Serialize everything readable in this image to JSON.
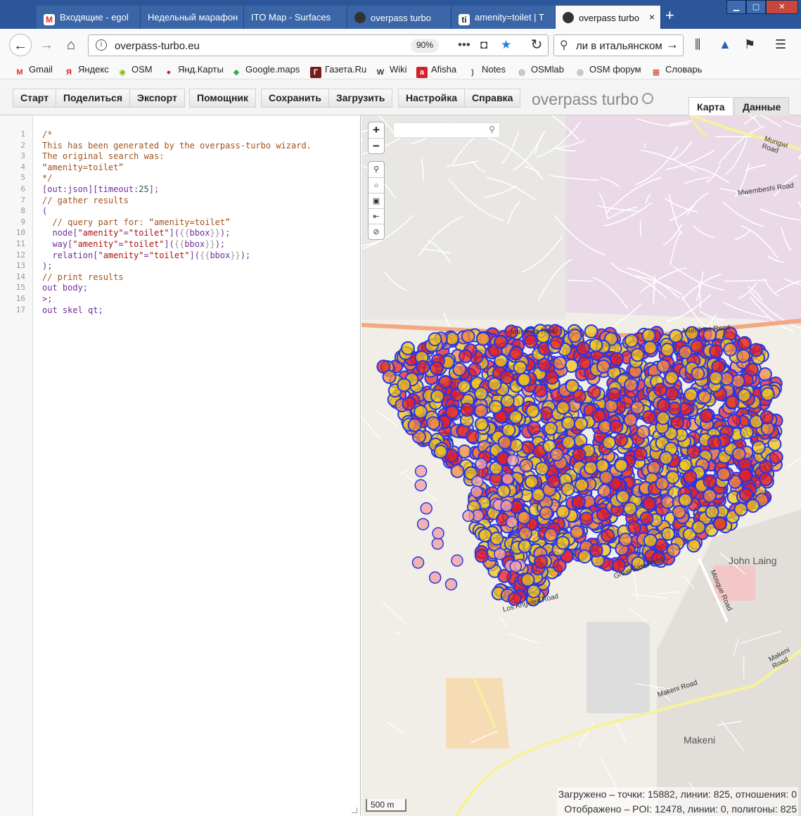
{
  "browser": {
    "tabs": [
      {
        "title": "Входящие - egol",
        "icon_color": "#d93025"
      },
      {
        "title": "Недельный марафон"
      },
      {
        "title": "ITO Map - Surfaces"
      },
      {
        "title": "overpass turbo",
        "icon_color": "#333333"
      },
      {
        "title": "amenity=toilet | T",
        "icon_color": "#222222"
      },
      {
        "title": "overpass turbo",
        "active": true,
        "icon_color": "#333333"
      }
    ],
    "close_tab": "×",
    "new_tab": "+",
    "url": "overpass-turbo.eu",
    "zoom": "90%",
    "search_text": "ли в итальянском"
  },
  "bookmarks": [
    {
      "label": "Gmail",
      "icon": "M",
      "color": "#d93025"
    },
    {
      "label": "Яндекс",
      "icon": "Я",
      "color": "#e02020"
    },
    {
      "label": "OSM",
      "icon": "◉",
      "color": "#7ab800"
    },
    {
      "label": "Янд.Карты",
      "icon": "📍",
      "color": "#e02020"
    },
    {
      "label": "Google.maps",
      "icon": "◆",
      "color": "#34a853"
    },
    {
      "label": "Газета.Ru",
      "icon": "Г",
      "color": "#7a1b1b"
    },
    {
      "label": "Wiki",
      "icon": "W",
      "color": "#333333"
    },
    {
      "label": "Afisha",
      "icon": "a",
      "color": "#d4202a"
    },
    {
      "label": "Notes",
      "icon": ")",
      "color": "#555555"
    },
    {
      "label": "OSMlab",
      "icon": "◎",
      "color": "#555555"
    },
    {
      "label": "OSM форум",
      "icon": "◎",
      "color": "#555555"
    },
    {
      "label": "Словарь",
      "icon": "▦",
      "color": "#c0392b"
    }
  ],
  "toolbar": {
    "group1": [
      "Старт",
      "Поделиться",
      "Экспорт"
    ],
    "group2": [
      "Помощник"
    ],
    "group3": [
      "Сохранить",
      "Загрузить"
    ],
    "group4": [
      "Настройка",
      "Справка"
    ],
    "brand": "overpass turbo",
    "view_tabs": [
      "Карта",
      "Данные"
    ]
  },
  "editor": {
    "lines": [
      [
        [
          "c-comment",
          "/*"
        ]
      ],
      [
        [
          "c-comment",
          "This has been generated by the overpass-turbo wizard."
        ]
      ],
      [
        [
          "c-comment",
          "The original search was:"
        ]
      ],
      [
        [
          "c-comment",
          "“amenity=toilet”"
        ]
      ],
      [
        [
          "c-comment",
          "*/"
        ]
      ],
      [
        [
          "c-key",
          "[out:json][timeout:"
        ],
        [
          "c-num",
          "25"
        ],
        [
          "c-key",
          "];"
        ]
      ],
      [
        [
          "c-comment",
          "// gather results"
        ]
      ],
      [
        [
          "c-key",
          "("
        ]
      ],
      [
        [
          "c-comment",
          "  // query part for: “amenity=toilet”"
        ]
      ],
      [
        [
          "c-key",
          "  node["
        ],
        [
          "c-str",
          "\"amenity\""
        ],
        [
          "c-key",
          "="
        ],
        [
          "c-str",
          "\"toilet\""
        ],
        [
          "c-key",
          "]("
        ],
        [
          "c-brace",
          "{{"
        ],
        [
          "c-key",
          "bbox"
        ],
        [
          "c-brace",
          "}}"
        ],
        [
          "c-key",
          ");"
        ]
      ],
      [
        [
          "c-key",
          "  way["
        ],
        [
          "c-str",
          "\"amenity\""
        ],
        [
          "c-key",
          "="
        ],
        [
          "c-str",
          "\"toilet\""
        ],
        [
          "c-key",
          "]("
        ],
        [
          "c-brace",
          "{{"
        ],
        [
          "c-key",
          "bbox"
        ],
        [
          "c-brace",
          "}}"
        ],
        [
          "c-key",
          ");"
        ]
      ],
      [
        [
          "c-key",
          "  relation["
        ],
        [
          "c-str",
          "\"amenity\""
        ],
        [
          "c-key",
          "="
        ],
        [
          "c-str",
          "\"toilet\""
        ],
        [
          "c-key",
          "]("
        ],
        [
          "c-brace",
          "{{"
        ],
        [
          "c-key",
          "bbox"
        ],
        [
          "c-brace",
          "}}"
        ],
        [
          "c-key",
          ");"
        ]
      ],
      [
        [
          "c-key",
          ");"
        ]
      ],
      [
        [
          "c-comment",
          "// print results"
        ]
      ],
      [
        [
          "c-key",
          "out body;"
        ]
      ],
      [
        [
          "c-key",
          ">;"
        ]
      ],
      [
        [
          "c-key",
          "out skel qt;"
        ]
      ]
    ]
  },
  "map": {
    "zoom_in": "+",
    "zoom_out": "−",
    "controls": [
      "⚲",
      "○",
      "▣",
      "⇤",
      "⊘"
    ],
    "search_icon": "⚲",
    "road_labels": [
      "Mumbwa Road",
      "Mungwi Road",
      "Mwembeshi Road",
      "Makeni Road",
      "Makeni Road",
      "Los Angeles Road",
      "Mosque Road",
      "Great East Road"
    ],
    "place_labels": [
      "John Laing",
      "Makeni"
    ],
    "scale_label": "500 m",
    "stats_loaded": "Загружено – точки: 15882, линии: 825, отношения: 0",
    "stats_shown": "Отображено – POI: 12478, линии: 0, полигоны: 825",
    "colors": {
      "marker_stroke": "#2437e6",
      "marker_red": "#e0202a",
      "marker_yellow": "#f0c419",
      "marker_orange": "#f28b40",
      "marker_pink": "#f4a3a3",
      "primary_road": "#f3a882",
      "secondary_road": "#f7f29a"
    }
  }
}
